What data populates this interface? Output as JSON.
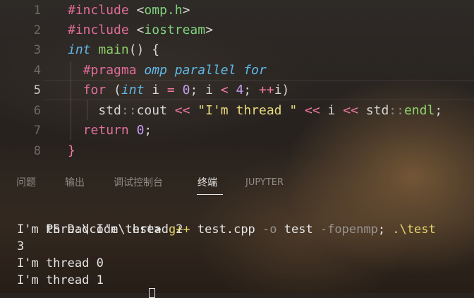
{
  "editor": {
    "line_numbers": [
      "1",
      "2",
      "3",
      "4",
      "5",
      "6",
      "7",
      "8"
    ],
    "lines": [
      [
        {
          "t": "#include",
          "c": "kw-pp"
        },
        {
          "t": " ",
          "c": "punc"
        },
        {
          "t": "<",
          "c": "punc"
        },
        {
          "t": "omp.h",
          "c": "inc"
        },
        {
          "t": ">",
          "c": "punc"
        }
      ],
      [
        {
          "t": "#include",
          "c": "kw-pp"
        },
        {
          "t": " ",
          "c": "punc"
        },
        {
          "t": "<",
          "c": "punc"
        },
        {
          "t": "iostream",
          "c": "inc"
        },
        {
          "t": ">",
          "c": "punc"
        }
      ],
      [
        {
          "t": "int",
          "c": "kw-type"
        },
        {
          "t": " ",
          "c": "punc"
        },
        {
          "t": "main",
          "c": "fn"
        },
        {
          "t": "() {",
          "c": "punc"
        }
      ],
      [
        {
          "t": "  ",
          "c": "punc"
        },
        {
          "t": "#pragma",
          "c": "kw-pp"
        },
        {
          "t": " ",
          "c": "punc"
        },
        {
          "t": "omp",
          "c": "italic-cyan"
        },
        {
          "t": " ",
          "c": "punc"
        },
        {
          "t": "parallel",
          "c": "italic-cyan"
        },
        {
          "t": " ",
          "c": "punc"
        },
        {
          "t": "for",
          "c": "italic-cyan"
        }
      ],
      [
        {
          "t": "  ",
          "c": "punc"
        },
        {
          "t": "for",
          "c": "kw"
        },
        {
          "t": " (",
          "c": "punc"
        },
        {
          "t": "int",
          "c": "kw-type"
        },
        {
          "t": " i ",
          "c": "punc"
        },
        {
          "t": "=",
          "c": "op"
        },
        {
          "t": " ",
          "c": "punc"
        },
        {
          "t": "0",
          "c": "num"
        },
        {
          "t": "; i ",
          "c": "punc"
        },
        {
          "t": "<",
          "c": "op"
        },
        {
          "t": " ",
          "c": "punc"
        },
        {
          "t": "4",
          "c": "num"
        },
        {
          "t": "; ",
          "c": "punc"
        },
        {
          "t": "++",
          "c": "op"
        },
        {
          "t": "i)",
          "c": "punc"
        }
      ],
      [
        {
          "t": "    ",
          "c": "punc"
        },
        {
          "t": "std",
          "c": "ns"
        },
        {
          "t": "::",
          "c": "scope"
        },
        {
          "t": "cout",
          "c": "ns"
        },
        {
          "t": " ",
          "c": "punc"
        },
        {
          "t": "<<",
          "c": "op"
        },
        {
          "t": " ",
          "c": "punc"
        },
        {
          "t": "\"I'm thread \"",
          "c": "str"
        },
        {
          "t": " ",
          "c": "punc"
        },
        {
          "t": "<<",
          "c": "op"
        },
        {
          "t": " i ",
          "c": "punc"
        },
        {
          "t": "<<",
          "c": "op"
        },
        {
          "t": " ",
          "c": "punc"
        },
        {
          "t": "std",
          "c": "ns"
        },
        {
          "t": "::",
          "c": "scope"
        },
        {
          "t": "endl",
          "c": "endl"
        },
        {
          "t": ";",
          "c": "punc"
        }
      ],
      [
        {
          "t": "  ",
          "c": "punc"
        },
        {
          "t": "return",
          "c": "kw"
        },
        {
          "t": " ",
          "c": "punc"
        },
        {
          "t": "0",
          "c": "num"
        },
        {
          "t": ";",
          "c": "punc"
        }
      ],
      [
        {
          "t": "}",
          "c": "op"
        }
      ]
    ]
  },
  "panel": {
    "tabs": [
      {
        "label": "问题",
        "active": false
      },
      {
        "label": "输出",
        "active": false
      },
      {
        "label": "调试控制台",
        "active": false
      },
      {
        "label": "终端",
        "active": true
      },
      {
        "label": "JUPYTER",
        "active": false
      }
    ]
  },
  "terminal": {
    "prompt": "PS D:\\code\\test> ",
    "command_parts": [
      {
        "t": "g++",
        "c": "t-cmd"
      },
      {
        "t": " test.cpp ",
        "c": "t-path"
      },
      {
        "t": "-o",
        "c": "t-flag"
      },
      {
        "t": " test ",
        "c": "t-path"
      },
      {
        "t": "-fopenmp",
        "c": "t-flag"
      },
      {
        "t": "; ",
        "c": "t-path"
      },
      {
        "t": ".\\test",
        "c": "t-cmd"
      }
    ],
    "output_lines": [
      "I'm thread I'm thread 2",
      "3",
      "I'm thread 0",
      "I'm thread 1"
    ]
  },
  "colors": {
    "keyword": "#e0709e",
    "type": "#5fb8e8",
    "function": "#8ed36b",
    "string": "#e6d97d",
    "number": "#c59cf0",
    "command": "#e9d56a"
  }
}
